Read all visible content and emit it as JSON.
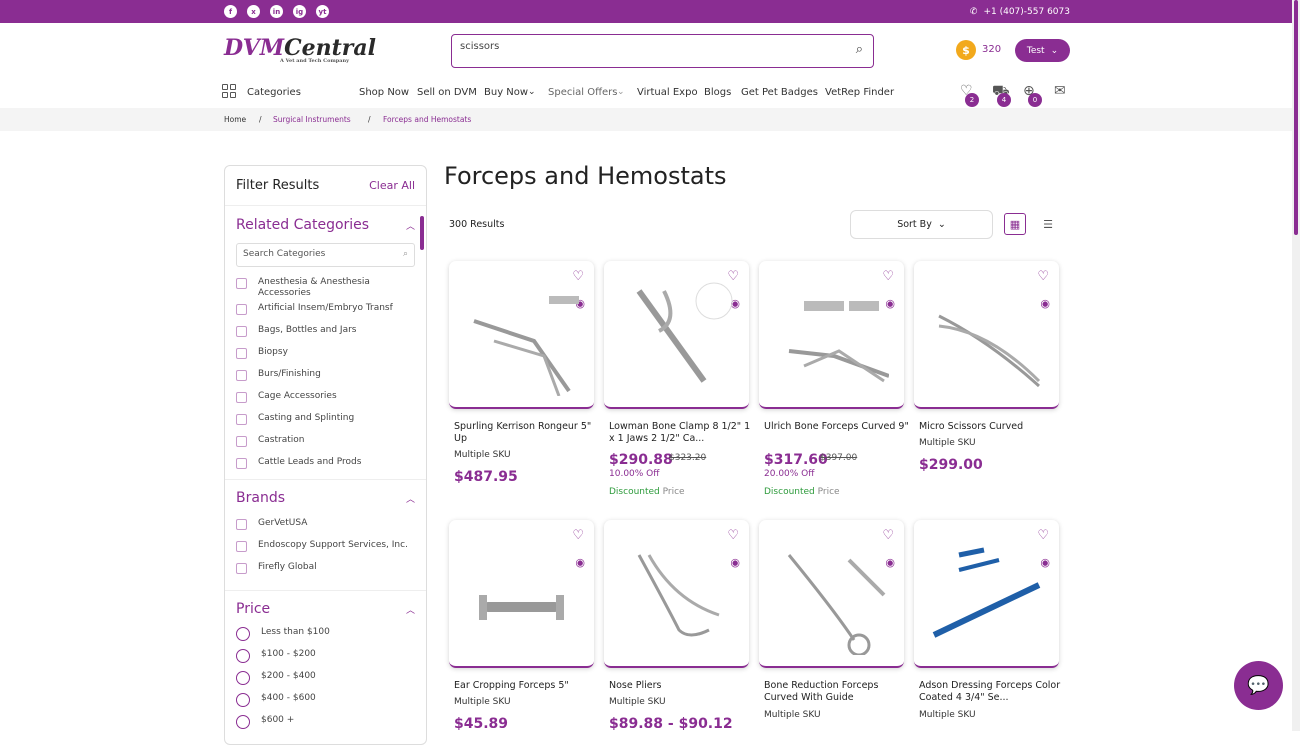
{
  "topbar": {
    "phone": "+1 (407)-557 6073",
    "social": [
      "f",
      "x",
      "in",
      "ig",
      "yt"
    ]
  },
  "header": {
    "logo_main": "DVM",
    "logo_sub": "Central",
    "logo_tag": "A Vet and Tech Company",
    "search_value": "scissors",
    "coins": "320",
    "user_label": "Test"
  },
  "nav": {
    "categories": "Categories",
    "items": [
      "Shop Now",
      "Sell on DVM",
      "Buy Now",
      "Special Offers",
      "Virtual Expo",
      "Blogs",
      "Get Pet Badges",
      "VetRep Finder"
    ],
    "wishlist_count": "2",
    "cart_count": "4",
    "compare_count": "0"
  },
  "breadcrumb": [
    "Home",
    "/",
    "Surgical Instruments",
    "/",
    "Forceps and Hemostats"
  ],
  "sidebar": {
    "filter_title": "Filter Results",
    "clear_all": "Clear All",
    "related_title": "Related Categories",
    "search_placeholder": "Search Categories",
    "categories": [
      "Anesthesia & Anesthesia Accessories",
      "Artificial Insem/Embryo Transf",
      "Bags, Bottles and Jars",
      "Biopsy",
      "Burs/Finishing",
      "Cage Accessories",
      "Casting and Splinting",
      "Castration",
      "Cattle Leads and Prods"
    ],
    "brands_title": "Brands",
    "brands": [
      "GerVetUSA",
      "Endoscopy Support Services, Inc.",
      "Firefly Global"
    ],
    "price_title": "Price",
    "prices": [
      "Less than $100",
      "$100 - $200",
      "$200 - $400",
      "$400 - $600",
      "$600 +"
    ]
  },
  "main": {
    "title": "Forceps and Hemostats",
    "results": "300 Results",
    "sort_label": "Sort By"
  },
  "products": [
    {
      "name": "Spurling Kerrison Rongeur 5\" Up",
      "sku": "Multiple SKU",
      "price": "$487.95"
    },
    {
      "name": "Lowman Bone Clamp 8 1/2\" 1 x 1 Jaws 2 1/2\" Ca...",
      "price": "$290.88",
      "old_price": "$323.20",
      "off": "10.00% Off",
      "disc_a": "Discounted",
      "disc_b": "Price"
    },
    {
      "name": "Ulrich Bone Forceps Curved 9\"",
      "price": "$317.60",
      "old_price": "$397.00",
      "off": "20.00% Off",
      "disc_a": "Discounted",
      "disc_b": "Price"
    },
    {
      "name": "Micro Scissors Curved",
      "sku": "Multiple SKU",
      "price": "$299.00"
    },
    {
      "name": "Ear Cropping Forceps 5\"",
      "sku": "Multiple SKU",
      "price": "$45.89"
    },
    {
      "name": "Nose Pliers",
      "sku": "Multiple SKU",
      "price": "$89.88 - $90.12"
    },
    {
      "name": "Bone Reduction Forceps Curved With Guide",
      "sku": "Multiple SKU"
    },
    {
      "name": "Adson Dressing Forceps Color Coated 4 3/4\" Se...",
      "sku": "Multiple SKU"
    }
  ],
  "colors": {
    "brand": "#8a2d92",
    "discount": "#2e9b3c",
    "coin": "#f2a91c"
  }
}
